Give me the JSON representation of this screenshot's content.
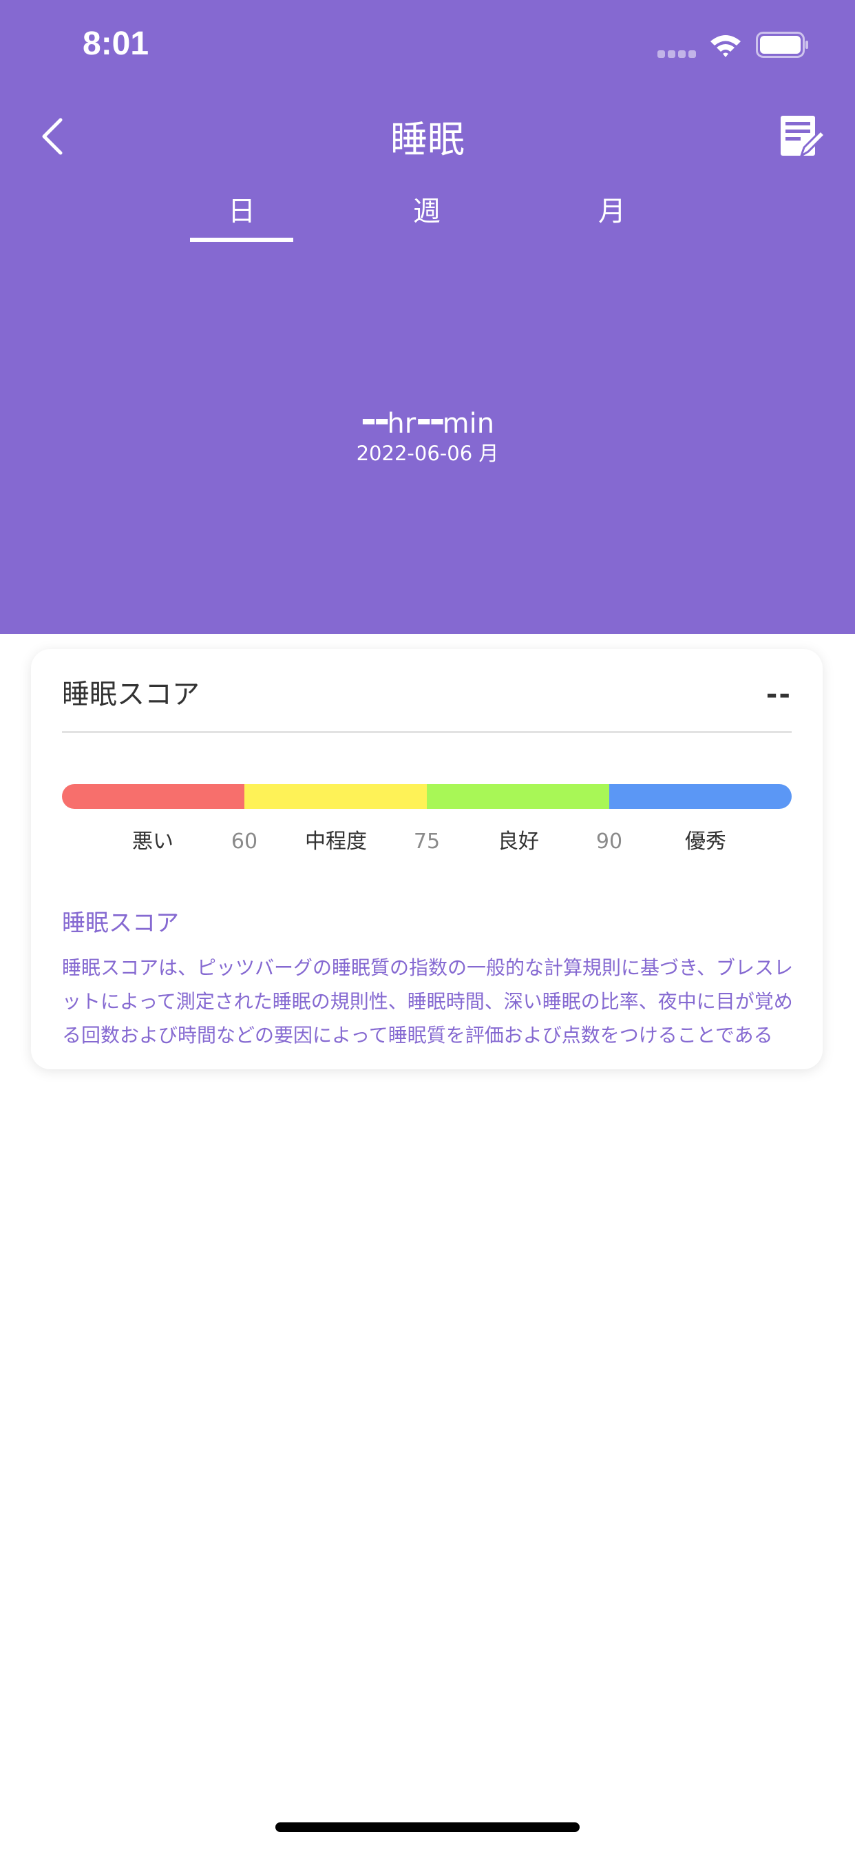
{
  "status_bar": {
    "time": "8:01"
  },
  "nav": {
    "title": "睡眠"
  },
  "tabs": [
    {
      "label": "日",
      "selected": true
    },
    {
      "label": "週",
      "selected": false
    },
    {
      "label": "月",
      "selected": false
    }
  ],
  "summary": {
    "hours_value": "--",
    "hours_unit": "hr",
    "minutes_value": "--",
    "minutes_unit": "min",
    "date": "2022-06-06 月"
  },
  "score_card": {
    "title": "睡眠スコア",
    "score": "--",
    "scale_labels": [
      "悪い",
      "60",
      "中程度",
      "75",
      "良好",
      "90",
      "優秀"
    ],
    "info_title": "睡眠スコア",
    "info_body": "睡眠スコアは、ピッツバーグの睡眠質の指数の一般的な計算規則に基づき、ブレスレットによって測定された睡眠の規則性、睡眠時間、深い睡眠の比率、夜中に目が覚める回数および時間などの要因によって睡眠質を評価および点数をつけることである"
  },
  "icons": {
    "back": "chevron-left-icon",
    "edit": "edit-note-icon",
    "wifi": "wifi-icon",
    "battery": "battery-icon"
  },
  "colors": {
    "accent": "#8569d1",
    "bad": "#f76f6c",
    "medium": "#fef257",
    "good": "#a8f756",
    "excellent": "#5b97f5"
  }
}
